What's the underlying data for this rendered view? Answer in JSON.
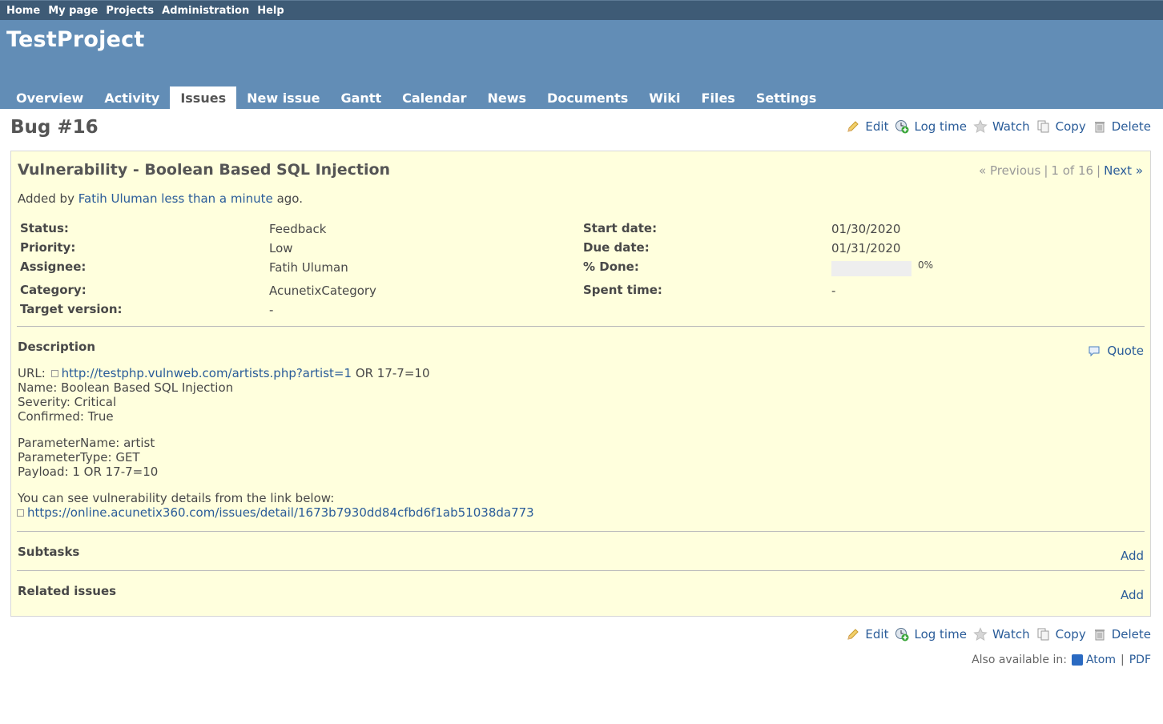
{
  "top_menu": [
    "Home",
    "My page",
    "Projects",
    "Administration",
    "Help"
  ],
  "project_title": "TestProject",
  "main_menu": [
    "Overview",
    "Activity",
    "Issues",
    "New issue",
    "Gantt",
    "Calendar",
    "News",
    "Documents",
    "Wiki",
    "Files",
    "Settings"
  ],
  "selected_tab": "Issues",
  "page_heading": "Bug #16",
  "actions": {
    "edit": "Edit",
    "log_time": "Log time",
    "watch": "Watch",
    "copy": "Copy",
    "delete": "Delete"
  },
  "issue": {
    "subject": "Vulnerability - Boolean Based SQL Injection",
    "nav": {
      "previous": "« Previous",
      "sep": "|",
      "position": "1 of 16",
      "next": "Next »"
    },
    "added_by_prefix": "Added by",
    "author": "Fatih Uluman",
    "time_ago": "less than a minute",
    "added_by_suffix": "ago.",
    "attributes": {
      "status_label": "Status:",
      "status": "Feedback",
      "priority_label": "Priority:",
      "priority": "Low",
      "assignee_label": "Assignee:",
      "assignee": "Fatih Uluman",
      "category_label": "Category:",
      "category": "AcunetixCategory",
      "target_version_label": "Target version:",
      "target_version": "-",
      "start_date_label": "Start date:",
      "start_date": "01/30/2020",
      "due_date_label": "Due date:",
      "due_date": "01/31/2020",
      "done_label": "% Done:",
      "done": "0%",
      "done_fraction": 0,
      "spent_time_label": "Spent time:",
      "spent_time": "-"
    },
    "description_title": "Description",
    "quote": "Quote",
    "description": {
      "url_prefix": "URL:",
      "url_link": "http://testphp.vulnweb.com/artists.php?artist=1",
      "url_suffix": "OR 17-7=10",
      "name": "Name: Boolean Based SQL Injection",
      "severity": "Severity: Critical",
      "confirmed": "Confirmed: True",
      "param_name": "ParameterName: artist",
      "param_type": "ParameterType: GET",
      "payload": "Payload: 1 OR 17-7=10",
      "details_text": "You can see vulnerability details from the link below:",
      "details_link": "https://online.acunetix360.com/issues/detail/1673b7930dd84cfbd6f1ab51038da773"
    },
    "subtasks_title": "Subtasks",
    "related_title": "Related issues",
    "add": "Add"
  },
  "also_available": {
    "label": "Also available in:",
    "atom": "Atom",
    "sep": "|",
    "pdf": "PDF"
  }
}
